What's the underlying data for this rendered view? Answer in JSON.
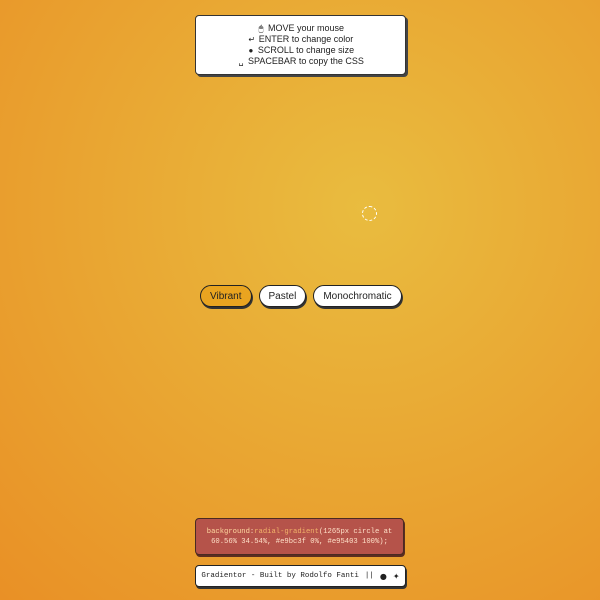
{
  "instructions": [
    {
      "icon": "🖱",
      "icon_name": "mouse-icon",
      "text": "MOVE your mouse"
    },
    {
      "icon": "↵",
      "icon_name": "enter-key-icon",
      "text": "ENTER to change color"
    },
    {
      "icon": "●",
      "icon_name": "scroll-wheel-icon",
      "text": "SCROLL to change size"
    },
    {
      "icon": "␣",
      "icon_name": "spacebar-icon",
      "text": "SPACEBAR to copy the CSS"
    }
  ],
  "palettes": {
    "vibrant": "Vibrant",
    "pastel": "Pastel",
    "monochromatic": "Monochromatic",
    "selected": "Vibrant"
  },
  "css_output": {
    "property": "background",
    "function": "radial-gradient",
    "args": "(1265px circle at 60.56% 34.54%, #e9bc3f 0%, #e95403 100%);"
  },
  "footer": {
    "text": "Gradientor - Built by Rodolfo Fanti",
    "separator": "||"
  },
  "colors": {
    "gradient_inner": "#e9bc3f",
    "gradient_outer": "#e95403",
    "active_button": "#e9a420"
  }
}
